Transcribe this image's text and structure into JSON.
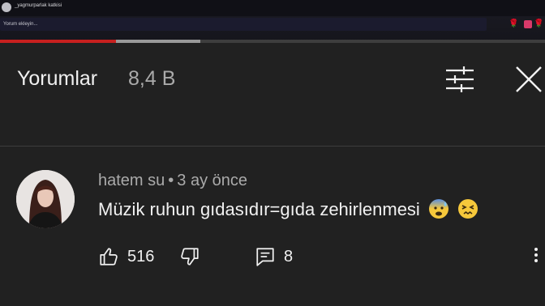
{
  "overlay": {
    "channel_name": "_yagmurparlak katkisi",
    "add_comment_placeholder": "Yorum ekleyin..."
  },
  "video_progress": {
    "played_fraction": 0.213,
    "buffered_fraction": 0.368
  },
  "panel": {
    "title": "Yorumlar",
    "count": "8,4 B"
  },
  "comment": {
    "author": "hatem su",
    "separator": "•",
    "time": "3 ay önce",
    "text": "Müzik ruhun gıdasıdır=gıda zehirlenmesi",
    "emojis": [
      "anxious-face-with-sweat",
      "confounded-face"
    ],
    "likes": "516",
    "replies": "8"
  },
  "colors": {
    "background": "#212121",
    "progress_played": "#c7201f",
    "secondary_text": "#aaaaaa"
  },
  "icons": [
    "filter-icon",
    "close-icon",
    "like-icon",
    "dislike-icon",
    "reply-icon",
    "more-vert-icon"
  ]
}
